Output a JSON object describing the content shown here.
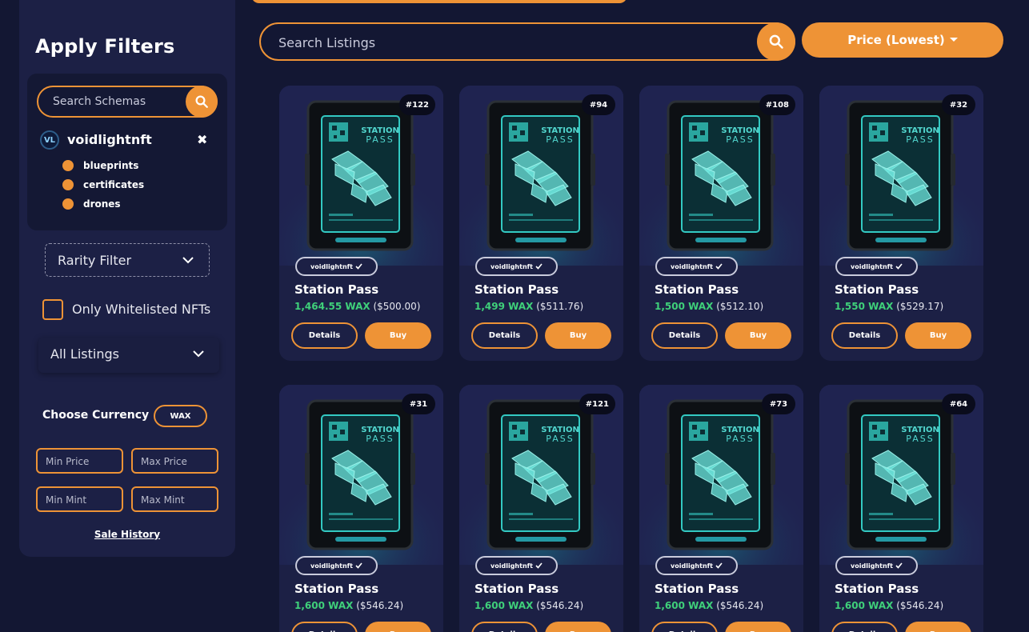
{
  "sidebar": {
    "title": "Apply Filters",
    "schema_search": {
      "placeholder": "Search Schemas"
    },
    "collection": {
      "logo_text": "VL",
      "name": "voidlightnft",
      "remove": "✖"
    },
    "schemas": [
      {
        "label": "blueprints"
      },
      {
        "label": "certificates"
      },
      {
        "label": "drones"
      }
    ],
    "rarity_filter": {
      "label": "Rarity Filter"
    },
    "whitelist": {
      "label": "Only Whitelisted NFTs"
    },
    "listings_filter": {
      "label": "All Listings"
    },
    "currency": {
      "label": "Choose Currency",
      "value": "WAX"
    },
    "min_price": {
      "placeholder": "Min Price"
    },
    "max_price": {
      "placeholder": "Max Price"
    },
    "min_mint": {
      "placeholder": "Min Mint"
    },
    "max_mint": {
      "placeholder": "Max Mint"
    },
    "sale_history": "Sale History"
  },
  "search": {
    "placeholder": "Search Listings"
  },
  "sort": {
    "label": "Price (Lowest)"
  },
  "card_labels": {
    "details": "Details",
    "buy": "Buy",
    "verified_icon": "check-icon"
  },
  "listings": [
    {
      "mint": "#122",
      "collection": "voidlightnft",
      "name": "Station Pass",
      "price_wax": "1,464.55 WAX",
      "price_usd": "($500.00)"
    },
    {
      "mint": "#94",
      "collection": "voidlightnft",
      "name": "Station Pass",
      "price_wax": "1,499 WAX",
      "price_usd": "($511.76)"
    },
    {
      "mint": "#108",
      "collection": "voidlightnft",
      "name": "Station Pass",
      "price_wax": "1,500 WAX",
      "price_usd": "($512.10)"
    },
    {
      "mint": "#32",
      "collection": "voidlightnft",
      "name": "Station Pass",
      "price_wax": "1,550 WAX",
      "price_usd": "($529.17)"
    },
    {
      "mint": "#31",
      "collection": "voidlightnft",
      "name": "Station Pass",
      "price_wax": "1,600 WAX",
      "price_usd": "($546.24)"
    },
    {
      "mint": "#121",
      "collection": "voidlightnft",
      "name": "Station Pass",
      "price_wax": "1,600 WAX",
      "price_usd": "($546.24)"
    },
    {
      "mint": "#73",
      "collection": "voidlightnft",
      "name": "Station Pass",
      "price_wax": "1,600 WAX",
      "price_usd": "($546.24)"
    },
    {
      "mint": "#64",
      "collection": "voidlightnft",
      "name": "Station Pass",
      "price_wax": "1,600 WAX",
      "price_usd": "($546.24)"
    }
  ],
  "card_art": {
    "line1": "STATION",
    "line2": "PASS"
  },
  "colors": {
    "accent": "#ee9336",
    "background": "#131733",
    "panel": "#1c2045",
    "price_green": "#3fd07a"
  }
}
